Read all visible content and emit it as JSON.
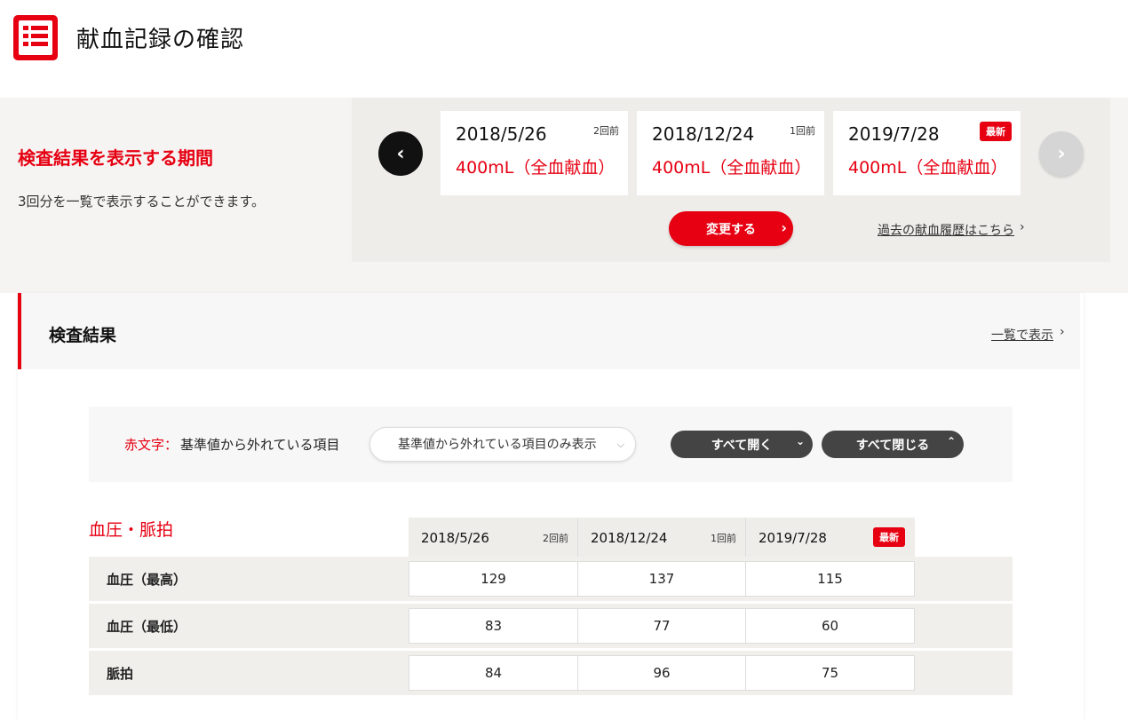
{
  "header": {
    "title": "献血記録の確認"
  },
  "period": {
    "title": "検査結果を表示する期間",
    "description": "3回分を一覧で表示することができます。",
    "cards": [
      {
        "date": "2018/5/26",
        "amount": "400mL（全血献血）",
        "tag": "2回前"
      },
      {
        "date": "2018/12/24",
        "amount": "400mL（全血献血）",
        "tag": "1回前"
      },
      {
        "date": "2019/7/28",
        "amount": "400mL（全血献血）",
        "badge": "最新"
      }
    ],
    "change_button": "変更する",
    "history_link": "過去の献血履歴はこちら"
  },
  "results": {
    "title": "検査結果",
    "list_link": "一覧で表示",
    "legend_red": "赤文字：",
    "legend_text": "基準値から外れている項目",
    "filter_select": "基準値から外れている項目のみ表示",
    "open_all": "すべて開く",
    "close_all": "すべて閉じる"
  },
  "bp_table": {
    "title": "血圧・脈拍",
    "columns": [
      {
        "date": "2018/5/26",
        "tag": "2回前"
      },
      {
        "date": "2018/12/24",
        "tag": "1回前"
      },
      {
        "date": "2019/7/28",
        "badge": "最新"
      }
    ],
    "rows": [
      {
        "label": "血圧（最高）",
        "values": [
          "129",
          "137",
          "115"
        ]
      },
      {
        "label": "血圧（最低）",
        "values": [
          "83",
          "77",
          "60"
        ]
      },
      {
        "label": "脈拍",
        "values": [
          "84",
          "96",
          "75"
        ]
      }
    ]
  },
  "colors": {
    "accent": "#e60012",
    "panel": "#eeedea",
    "dark_button": "#444444"
  }
}
